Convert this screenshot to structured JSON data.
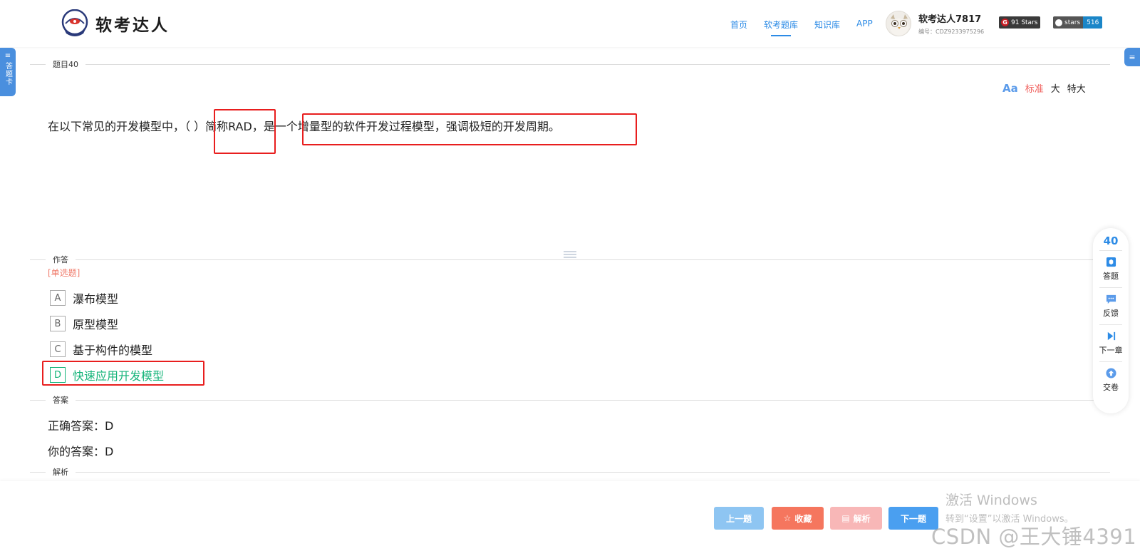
{
  "header": {
    "brand": "软考达人",
    "nav": [
      {
        "label": "首页"
      },
      {
        "label": "软考题库"
      },
      {
        "label": "知识库"
      },
      {
        "label": "APP"
      }
    ],
    "user": {
      "name": "软考达人7817",
      "id": "编号：CDZ9233975296"
    },
    "badges": {
      "gitee_label": "91 Stars",
      "github_label": "stars",
      "github_count": "516"
    }
  },
  "side": {
    "answer_card": "答题卡"
  },
  "question_section": {
    "label": "题目40",
    "font_size": {
      "standard": "标准",
      "large": "大",
      "xlarge": "特大"
    },
    "text": "在以下常见的开发模型中，（ ）简称RAD，是一个增量型的软件开发过程模型，强调极短的开发周期。"
  },
  "answer_section": {
    "label": "作答",
    "type": "[单选题]",
    "options": [
      {
        "key": "A",
        "text": "瀑布模型"
      },
      {
        "key": "B",
        "text": "原型模型"
      },
      {
        "key": "C",
        "text": "基于构件的模型"
      },
      {
        "key": "D",
        "text": "快速应用开发模型"
      }
    ],
    "selected": "D"
  },
  "result_section": {
    "label": "答案",
    "correct": "正确答案：D",
    "yours": "你的答案：D"
  },
  "analysis_section": {
    "label": "解析"
  },
  "float_panel": {
    "number": "40",
    "items": [
      {
        "label": "答题"
      },
      {
        "label": "反馈"
      },
      {
        "label": "下一章"
      },
      {
        "label": "交卷"
      }
    ]
  },
  "buttons": {
    "prev": "上一题",
    "favorite": "收藏",
    "analysis": "解析",
    "next": "下一题"
  },
  "overlay": {
    "windows_line1": "激活 Windows",
    "windows_line2": "转到“设置”以激活 Windows。",
    "csdn": "CSDN @王大锤4391"
  },
  "colors": {
    "accent": "#2c8be6",
    "selected": "#15b47a",
    "highlight_box": "#e81e1e"
  }
}
